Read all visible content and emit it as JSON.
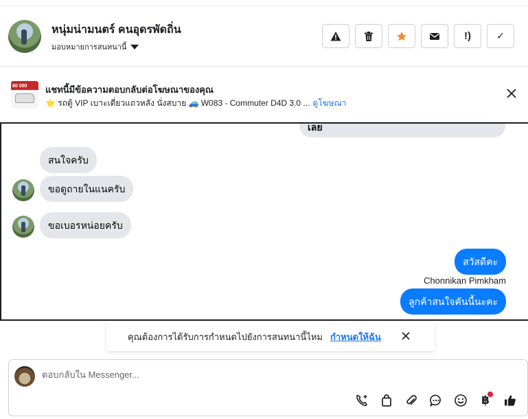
{
  "header": {
    "contact_name": "หนุ่มน่ามนตร์ คนอุดรพัดถิ่น",
    "assign_label": "มอบหมายการสนทนานี้",
    "tools": [
      {
        "name": "spam-icon",
        "glyph": "!"
      },
      {
        "name": "trash-icon"
      },
      {
        "name": "star-icon"
      },
      {
        "name": "mail-icon"
      },
      {
        "name": "follow-up-icon",
        "glyph": "!)"
      },
      {
        "name": "check-icon",
        "glyph": "✓"
      }
    ],
    "colors": {
      "star": "#f08d2e"
    }
  },
  "ad_banner": {
    "title": "แชทนี้มีข้อความตอบกลับต่อโฆษณาของคุณ",
    "subtitle": "⭐ รถตู้ VIP เบาะเดี่ยวแถวหลัง นั่งสบาย 🚙 W083 - Commuter D4D 3.0 ...",
    "link": "ดูโฆษณา",
    "thumb_price": "60 000"
  },
  "chat": {
    "partial_message": "เลย",
    "incoming": [
      "สนใจครับ",
      "ขอดูถายในแนครับ",
      "ขอเบอรหน่อยครับ"
    ],
    "outgoing": [
      "สวัสดีคะ",
      "ลูกค้าสนใจคันนี้นะคะ"
    ],
    "sender_name": "Chonnikan Pimkham",
    "colors": {
      "incoming_bg": "#e4e6eb",
      "outgoing_bg": "#0a7cff"
    }
  },
  "assign_prompt": {
    "text": "คุณต้องการได้รับการกำหนดไปยังการสนทนานี้ไหม",
    "link": "กำหนดให้ฉัน"
  },
  "composer": {
    "placeholder": "ตอบกลับใน Messenger...",
    "value": "",
    "baht_glyph": "฿",
    "tools": [
      "call-icon",
      "shopping-bag-icon",
      "attachment-icon",
      "saved-replies-icon",
      "emoji-icon",
      "payment-icon",
      "like-icon"
    ]
  }
}
